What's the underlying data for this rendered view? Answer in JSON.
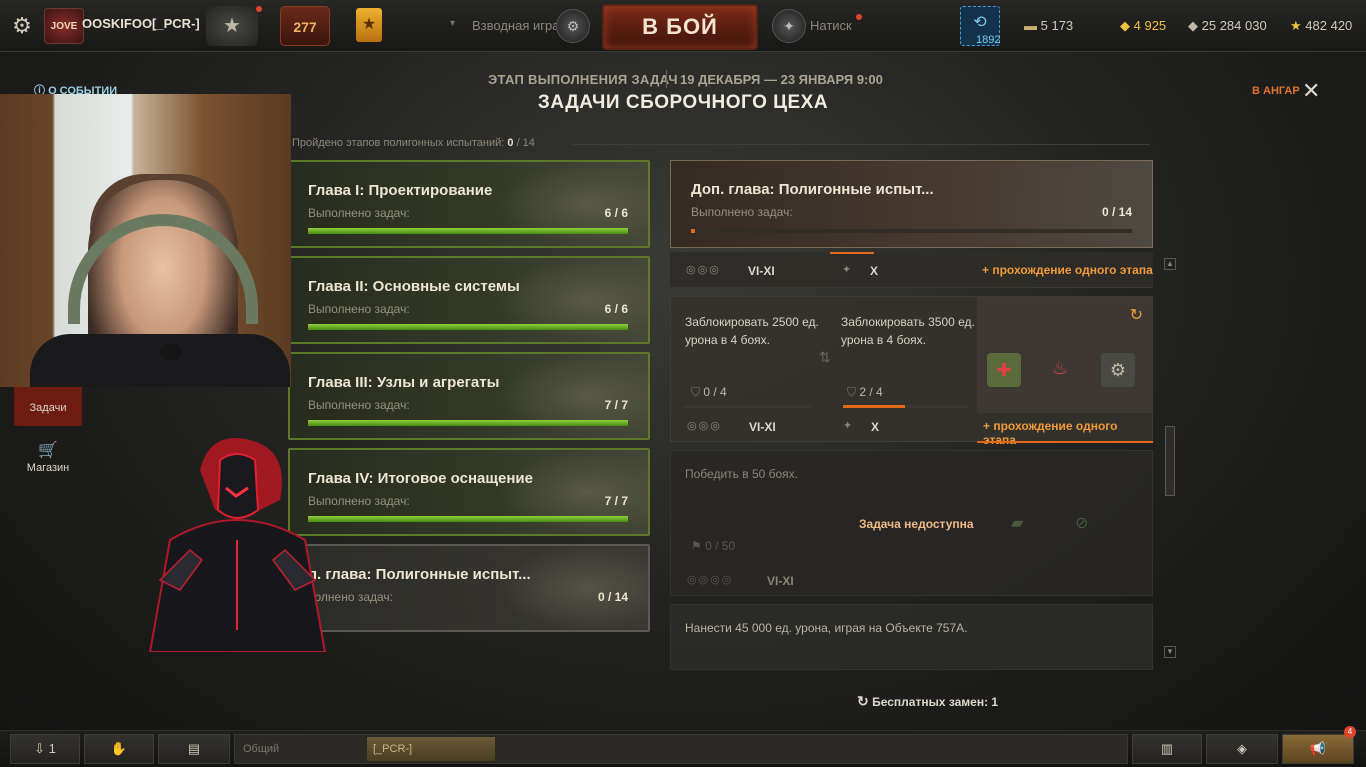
{
  "topbar": {
    "clan_tag_badge": "JOVE",
    "player_name": "OOSKIFOO[_PCR-]",
    "battle_count": "277",
    "platoon_label": "Взводная игра",
    "battle_button": "В БОЙ",
    "mode_label": "Натиск",
    "premium_days": "1892",
    "currencies": [
      {
        "icon": "bonds-icon",
        "value": "5 173"
      },
      {
        "icon": "gold-icon",
        "value": "4 925"
      },
      {
        "icon": "credits-icon",
        "value": "25 284 030"
      },
      {
        "icon": "free-xp-icon",
        "value": "482 420"
      }
    ]
  },
  "header": {
    "stage_label": "ЭТАП ВЫПОЛНЕНИЯ ЗАДАЧ",
    "stage_dates": "19 ДЕКАБРЯ — 23 ЯНВАРЯ 9:00",
    "title": "ЗАДАЧИ СБОРОЧНОГО ЦЕХА",
    "about_link": "О СОБЫТИИ",
    "to_hangar": "В АНГАР",
    "progress_prefix": "Пройдено этапов полигонных испытаний:",
    "progress_done": "0",
    "progress_total": "/ 14"
  },
  "chapters": [
    {
      "title": "Глава I: Проектирование",
      "sub": "Выполнено задач:",
      "count": "6 / 6",
      "progress": 1.0
    },
    {
      "title": "Глава II: Основные системы",
      "sub": "Выполнено задач:",
      "count": "6 / 6",
      "progress": 1.0
    },
    {
      "title": "Глава III: Узлы и агрегаты",
      "sub": "Выполнено задач:",
      "count": "7 / 7",
      "progress": 1.0
    },
    {
      "title": "Глава IV: Итоговое оснащение",
      "sub": "Выполнено задач:",
      "count": "7 / 7",
      "progress": 1.0
    },
    {
      "title": "п. глава: Полигонные испыт...",
      "sub": "полнено задач:",
      "count": "0 / 14",
      "progress": 0.0
    }
  ],
  "selected": {
    "title": "Доп. глава: Полигонные испыт...",
    "sub": "Выполнено задач:",
    "count": "0 / 14",
    "progress": 0.01
  },
  "top_row": {
    "tier_left": "VI-XI",
    "tier_right": "X",
    "bonus": "+ прохождение одного этапа"
  },
  "task_active": {
    "cond1": "Заблокировать 2500 ед. урона в 4 боях.",
    "cond1_progress": "0 / 4",
    "cond1_fill": 0.0,
    "cond2": "Заблокировать 3500 ед. урона в 4 боях.",
    "cond2_progress": "2 / 4",
    "cond2_fill": 0.5,
    "tier_left": "VI-XI",
    "tier_right": "X",
    "bonus": "+ прохождение одного этапа"
  },
  "task_locked": {
    "cond": "Победить в 50 боях.",
    "unavailable": "Задача недоступна",
    "progress": "0 / 50",
    "tier": "VI-XI"
  },
  "task_next": {
    "cond": "Нанести 45 000 ед. урона, играя на Объекте 757А."
  },
  "free_swaps": "Бесплатных замен: 1",
  "leftnav": {
    "tasks": "Задачи",
    "shop": "Магазин"
  },
  "bottombar": {
    "players_online": "1",
    "chat_channel": "Общий",
    "clan_channel": "[_PCR-]",
    "notif_count": "4"
  }
}
